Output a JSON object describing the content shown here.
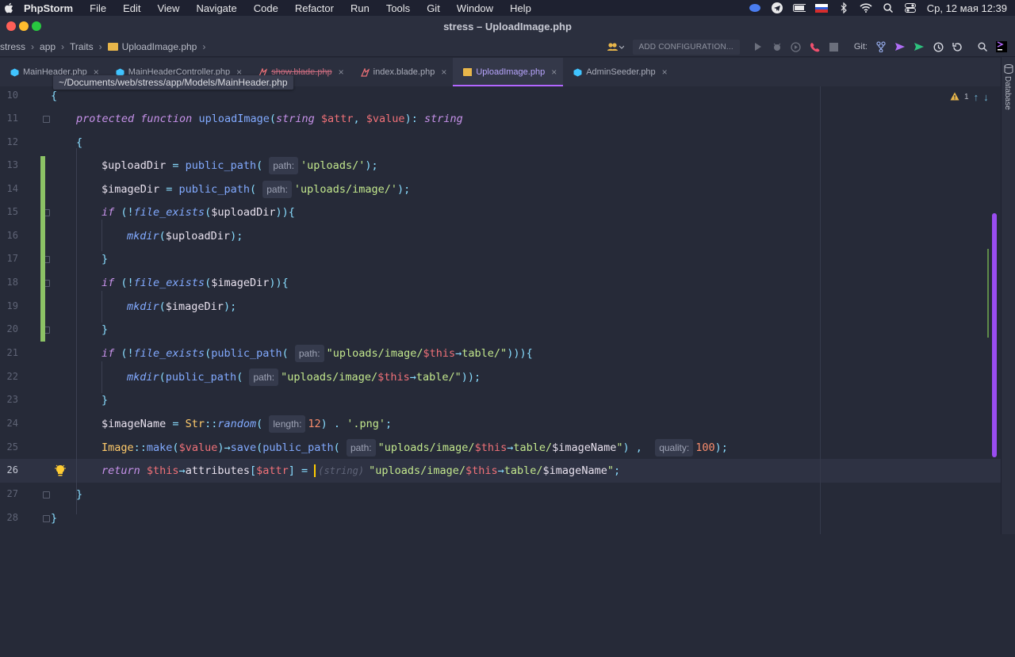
{
  "menubar": {
    "app": "PhpStorm",
    "items": [
      "File",
      "Edit",
      "View",
      "Navigate",
      "Code",
      "Refactor",
      "Run",
      "Tools",
      "Git",
      "Window",
      "Help"
    ],
    "clock": "Ср, 12 мая  12:39"
  },
  "window": {
    "title": "stress – UploadImage.php"
  },
  "breadcrumb": [
    "stress",
    "app",
    "Traits",
    "UploadImage.php"
  ],
  "toolbar": {
    "config_label": "ADD CONFIGURATION...",
    "git_label": "Git:"
  },
  "tabs": [
    {
      "label": "MainHeader.php",
      "icon": "php-class-icon",
      "color": "#40c4ff",
      "strike": false
    },
    {
      "label": "MainHeaderController.php",
      "icon": "php-class-icon",
      "color": "#40c4ff",
      "strike": false
    },
    {
      "label": "show.blade.php",
      "icon": "blade-icon",
      "color": "#f07178",
      "strike": true
    },
    {
      "label": "index.blade.php",
      "icon": "blade-icon",
      "color": "#f07178",
      "strike": false
    },
    {
      "label": "UploadImage.php",
      "icon": "php-trait-icon",
      "color": "#e8b64a",
      "strike": false,
      "active": true
    },
    {
      "label": "AdminSeeder.php",
      "icon": "php-class-icon",
      "color": "#40c4ff",
      "strike": false
    }
  ],
  "tooltip": "~/Documents/web/stress/app/Models/MainHeader.php",
  "sidebar": {
    "database_label": "Database"
  },
  "inspection": {
    "warning_count": "1"
  },
  "editor": {
    "current_line": "26",
    "line_numbers": [
      "10",
      "11",
      "12",
      "13",
      "14",
      "15",
      "16",
      "17",
      "18",
      "19",
      "20",
      "21",
      "22",
      "23",
      "24",
      "25",
      "26",
      "27",
      "28"
    ],
    "hints": {
      "path": "path:",
      "length": "length:",
      "quality": "quality:",
      "string_cast": "(string)"
    },
    "strings": {
      "uploads": "'uploads/'",
      "uploads_image": "'uploads/image/'",
      "png": "'.png'"
    },
    "numbers": {
      "length": "12",
      "quality": "100"
    }
  }
}
